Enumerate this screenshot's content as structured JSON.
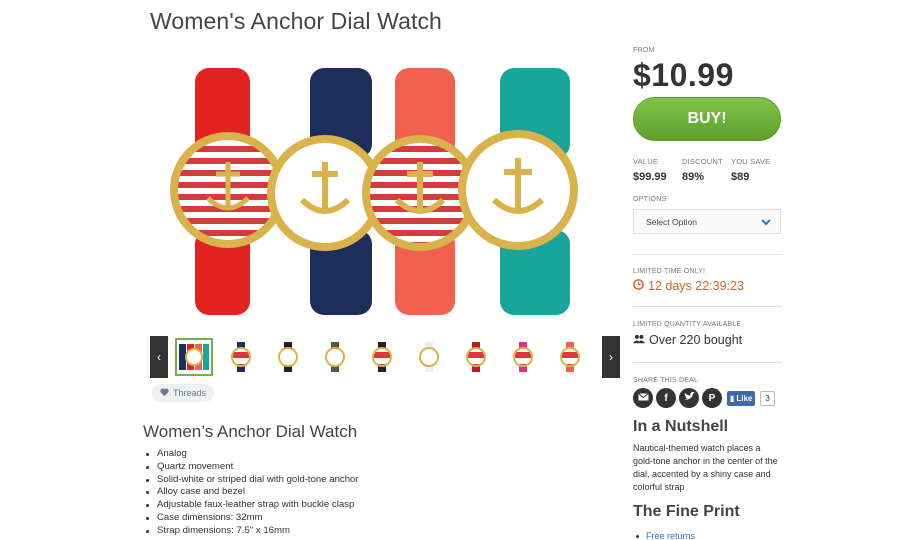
{
  "page": {
    "title": "Women's Anchor Dial Watch"
  },
  "gallery": {
    "prev_label": "‹",
    "next_label": "›",
    "thumbnails": [
      {
        "name": "thumb-multi",
        "active": true
      },
      {
        "name": "thumb-navy-stripe"
      },
      {
        "name": "thumb-black-white"
      },
      {
        "name": "thumb-olive-white"
      },
      {
        "name": "thumb-black-stripe"
      },
      {
        "name": "thumb-white-white"
      },
      {
        "name": "thumb-red-stripe"
      },
      {
        "name": "thumb-pink-stripe"
      },
      {
        "name": "thumb-coral-stripe"
      }
    ],
    "tag_label": "Threads"
  },
  "description": {
    "title": "Women’s Anchor Dial Watch",
    "features": [
      "Analog",
      "Quartz movement",
      "Solid-white or striped dial with gold-tone anchor",
      "Alloy case and bezel",
      "Adjustable faux-leather strap with buckle clasp",
      "Case dimensions: 32mm",
      "Strap dimensions: 7.5\" x 16mm"
    ]
  },
  "pricing": {
    "from_label": "FROM",
    "price": "$10.99",
    "buy_label": "BUY!",
    "value_label": "VALUE",
    "value": "$99.99",
    "discount_label": "DISCOUNT",
    "discount": "89%",
    "save_label": "YOU SAVE",
    "save": "$89"
  },
  "options": {
    "label": "OPTIONS",
    "selected": "Select Option"
  },
  "limited_time": {
    "label": "LIMITED TIME ONLY!",
    "countdown": "12 days 22:39:23"
  },
  "limited_quantity": {
    "label": "LIMITED QUANTITY AVAILABLE",
    "bought": "Over 220 bought"
  },
  "share": {
    "label": "SHARE THIS DEAL",
    "like_label": "Like",
    "like_count": "3"
  },
  "nutshell": {
    "title": "In a Nutshell",
    "text": "Nautical-themed watch places a gold-tone anchor in the center of the dial, accented by a shiny case and colorful strap"
  },
  "fine_print": {
    "title": "The Fine Print",
    "first_item": "Free returns"
  },
  "colors": {
    "accent_green": "#6ab236",
    "timer_orange": "#d2622a",
    "facebook_blue": "#4267b2"
  }
}
